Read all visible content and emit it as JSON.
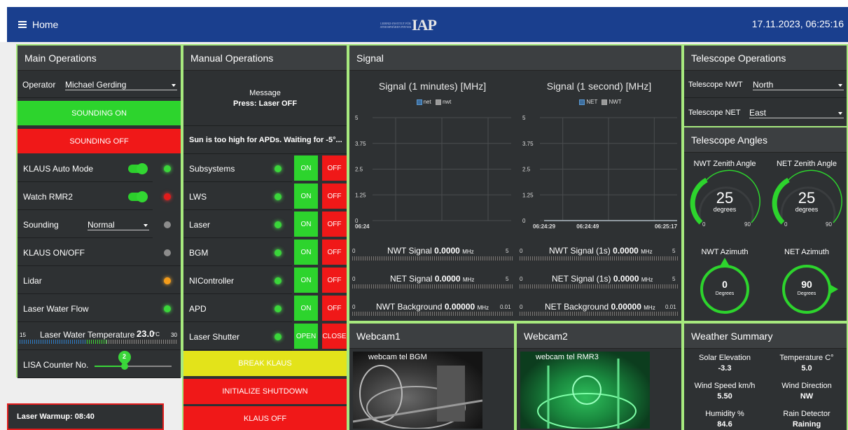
{
  "nav": {
    "home_label": "Home",
    "datetime": "17.11.2023, 06:25:16",
    "logo_text": "IAP",
    "logo_small": "LEIBNIZ-INSTITUT FÜR ATMOSPHÄREN PHYSIK"
  },
  "main_ops": {
    "title": "Main Operations",
    "operator_label": "Operator",
    "operator_value": "Michael Gerding",
    "sounding_on": "SOUNDING ON",
    "sounding_off": "SOUNDING OFF",
    "klaus_auto": "KLAUS Auto Mode",
    "watch_rmr2": "Watch RMR2",
    "sounding_label": "Sounding",
    "sounding_value": "Normal",
    "klaus_onoff": "KLAUS ON/OFF",
    "lidar": "Lidar",
    "laser_water_flow": "Laser Water Flow",
    "lwt_label": "Laser Water Temperature",
    "lwt_value": "23.0",
    "lwt_unit": "°C",
    "lwt_min": "15",
    "lwt_max": "30",
    "lisa_label": "LISA Counter No.",
    "lisa_value": "2",
    "warmup": "Laser Warmup: 08:40"
  },
  "manual_ops": {
    "title": "Manual Operations",
    "message_label": "Message",
    "message_value": "Press: Laser OFF",
    "sun_msg": "Sun is too high for APDs. Waiting for -5°...",
    "rows": [
      {
        "label": "Subsystems",
        "on": "ON",
        "off": "OFF"
      },
      {
        "label": "LWS",
        "on": "ON",
        "off": "OFF"
      },
      {
        "label": "Laser",
        "on": "ON",
        "off": "OFF"
      },
      {
        "label": "BGM",
        "on": "ON",
        "off": "OFF"
      },
      {
        "label": "NIController",
        "on": "ON",
        "off": "OFF"
      },
      {
        "label": "APD",
        "on": "ON",
        "off": "OFF"
      },
      {
        "label": "Laser Shutter",
        "on": "OPEN",
        "off": "CLOSE"
      }
    ],
    "break_klaus": "BREAK KLAUS",
    "init_shutdown": "INITIALIZE SHUTDOWN",
    "klaus_off": "KLAUS OFF"
  },
  "signal": {
    "title": "Signal",
    "chart1_title": "Signal (1 minutes) [MHz]",
    "chart1_leg1": "net",
    "chart1_leg2": "nwt",
    "chart2_title": "Signal (1 second) [MHz]",
    "chart2_leg1": "NET",
    "chart2_leg2": "NWT",
    "nwt_signal_label": "NWT Signal",
    "nwt_signal_value": "0.0000",
    "net_signal_label": "NET Signal",
    "net_signal_value": "0.0000",
    "nwt_bg_label": "NWT Background",
    "nwt_bg_value": "0.00000",
    "nwt_signal1s_label": "NWT Signal (1s)",
    "nwt_signal1s_value": "0.0000",
    "net_signal1s_label": "NET Signal (1s)",
    "net_signal1s_value": "0.0000",
    "net_bg_label": "NET Background",
    "net_bg_value": "0.00000",
    "unit": "MHz",
    "min": "0",
    "max": "5",
    "bg_max": "0.01"
  },
  "chart_data": [
    {
      "type": "line",
      "title": "Signal (1 minutes) [MHz]",
      "series": [
        {
          "name": "net",
          "values": []
        },
        {
          "name": "nwt",
          "values": []
        }
      ],
      "yticks": [
        "0",
        "1.25",
        "2.5",
        "3.75",
        "5"
      ],
      "xticks": [
        "06:24"
      ],
      "ylim": [
        0,
        5
      ]
    },
    {
      "type": "line",
      "title": "Signal (1 second) [MHz]",
      "series": [
        {
          "name": "NET",
          "values": [
            0,
            0
          ]
        },
        {
          "name": "NWT",
          "values": [
            0,
            0
          ]
        }
      ],
      "yticks": [
        "0",
        "1.25",
        "2.5",
        "3.75",
        "5"
      ],
      "xticks": [
        "06:24:29",
        "06:24:49",
        "06:25:17"
      ],
      "ylim": [
        0,
        5
      ]
    }
  ],
  "webcam": {
    "cam1_title": "Webcam1",
    "cam1_caption": "webcam tel BGM",
    "cam2_title": "Webcam2",
    "cam2_caption": "webcam tel RMR3"
  },
  "tel_ops": {
    "title": "Telescope Operations",
    "nwt_label": "Telescope NWT",
    "nwt_value": "North",
    "net_label": "Telescope NET",
    "net_value": "East"
  },
  "tel_angles": {
    "title": "Telescope Angles",
    "nwt_zenith_label": "NWT Zenith Angle",
    "nwt_zenith_value": "25",
    "net_zenith_label": "NET Zenith Angle",
    "net_zenith_value": "25",
    "zenith_unit": "degrees",
    "zenith_min": "0",
    "zenith_max": "90",
    "nwt_az_label": "NWT Azimuth",
    "nwt_az_value": "0",
    "net_az_label": "NET Azimuth",
    "net_az_value": "90",
    "az_unit": "Degrees"
  },
  "weather": {
    "title": "Weather Summary",
    "solar_label": "Solar Elevation",
    "solar_value": "-3.3",
    "temp_label": "Temperature C°",
    "temp_value": "5.0",
    "wind_speed_label": "Wind Speed km/h",
    "wind_speed_value": "5.50",
    "wind_dir_label": "Wind Direction",
    "wind_dir_value": "NW",
    "humidity_label": "Humidity %",
    "humidity_value": "84.6",
    "rain_label": "Rain Detector",
    "rain_value": "Raining"
  },
  "colors": {
    "accent_green": "#2dd42d",
    "alarm_red": "#f01818",
    "warn_yellow": "#e3e31a",
    "nav_blue": "#1a3f8e",
    "panel_border": "#a7e97e"
  }
}
